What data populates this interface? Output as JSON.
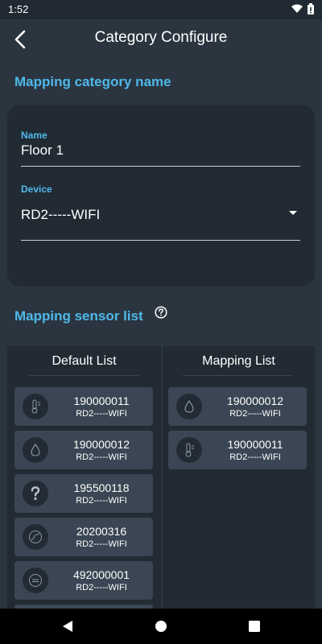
{
  "status_bar": {
    "time": "1:52",
    "icons": [
      "wifi-icon",
      "battery-icon"
    ]
  },
  "app_bar": {
    "title": "Category Configure"
  },
  "mapping_category": {
    "section_title": "Mapping category name",
    "name_label": "Name",
    "name_value": "Floor 1",
    "device_label": "Device",
    "device_value": "RD2-----WIFI"
  },
  "mapping_sensor": {
    "section_title": "Mapping sensor list",
    "default_list": {
      "title": "Default List",
      "items": [
        {
          "id": "190000011",
          "device": "RD2-----WIFI",
          "icon": "thermometer-icon"
        },
        {
          "id": "190000012",
          "device": "RD2-----WIFI",
          "icon": "water-drop-icon"
        },
        {
          "id": "195500118",
          "device": "RD2-----WIFI",
          "icon": "question-icon"
        },
        {
          "id": "20200316",
          "device": "RD2-----WIFI",
          "icon": "waveform-icon"
        },
        {
          "id": "492000001",
          "device": "RD2-----WIFI",
          "icon": "meter-icon"
        }
      ]
    },
    "mapping_list": {
      "title": "Mapping List",
      "items": [
        {
          "id": "190000012",
          "device": "RD2-----WIFI",
          "icon": "water-drop-icon"
        },
        {
          "id": "190000011",
          "device": "RD2-----WIFI",
          "icon": "thermometer-icon"
        }
      ]
    }
  },
  "colors": {
    "accent": "#4fb8e8",
    "background": "#2b3540",
    "card": "#222b34",
    "list_item": "#3a4653"
  }
}
